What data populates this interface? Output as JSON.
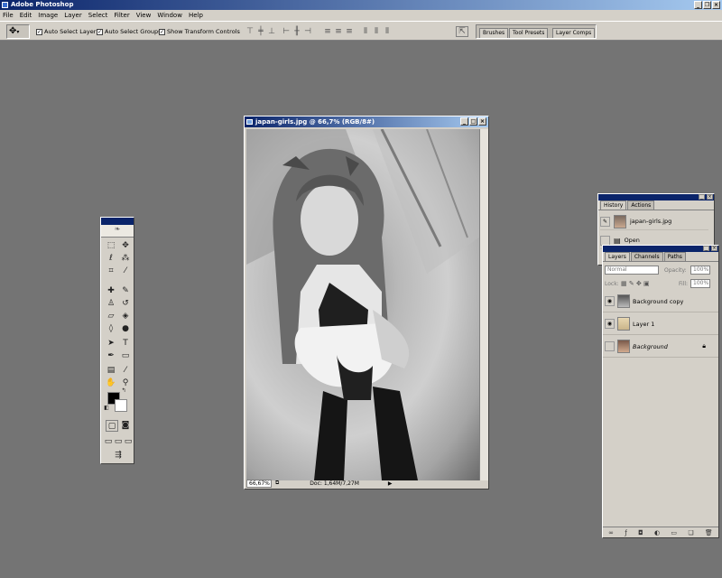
{
  "app": {
    "title": "Adobe Photoshop"
  },
  "menu": [
    "File",
    "Edit",
    "Image",
    "Layer",
    "Select",
    "Filter",
    "View",
    "Window",
    "Help"
  ],
  "options": {
    "auto_select_layer": "Auto Select Layer",
    "auto_select_groups": "Auto Select Groups",
    "show_transform_controls": "Show Transform Controls"
  },
  "well_tabs": [
    "Brushes",
    "Tool Presets",
    "Layer Comps"
  ],
  "document": {
    "title": "japan-girls.jpg @ 66,7% (RGB/8#)",
    "zoom": "66,67%",
    "doc_info": "Doc: 1,64M/7,27M"
  },
  "history": {
    "tabs": [
      "History",
      "Actions"
    ],
    "snapshot": "japan-girls.jpg",
    "step": "Open"
  },
  "layers": {
    "tabs": [
      "Layers",
      "Channels",
      "Paths"
    ],
    "blend_mode": "Normal",
    "opacity_label": "Opacity:",
    "opacity_value": "100%",
    "lock_label": "Lock:",
    "fill_label": "Fill:",
    "fill_value": "100%",
    "items": [
      {
        "name": "Background copy"
      },
      {
        "name": "Layer 1"
      },
      {
        "name": "Background"
      }
    ]
  }
}
